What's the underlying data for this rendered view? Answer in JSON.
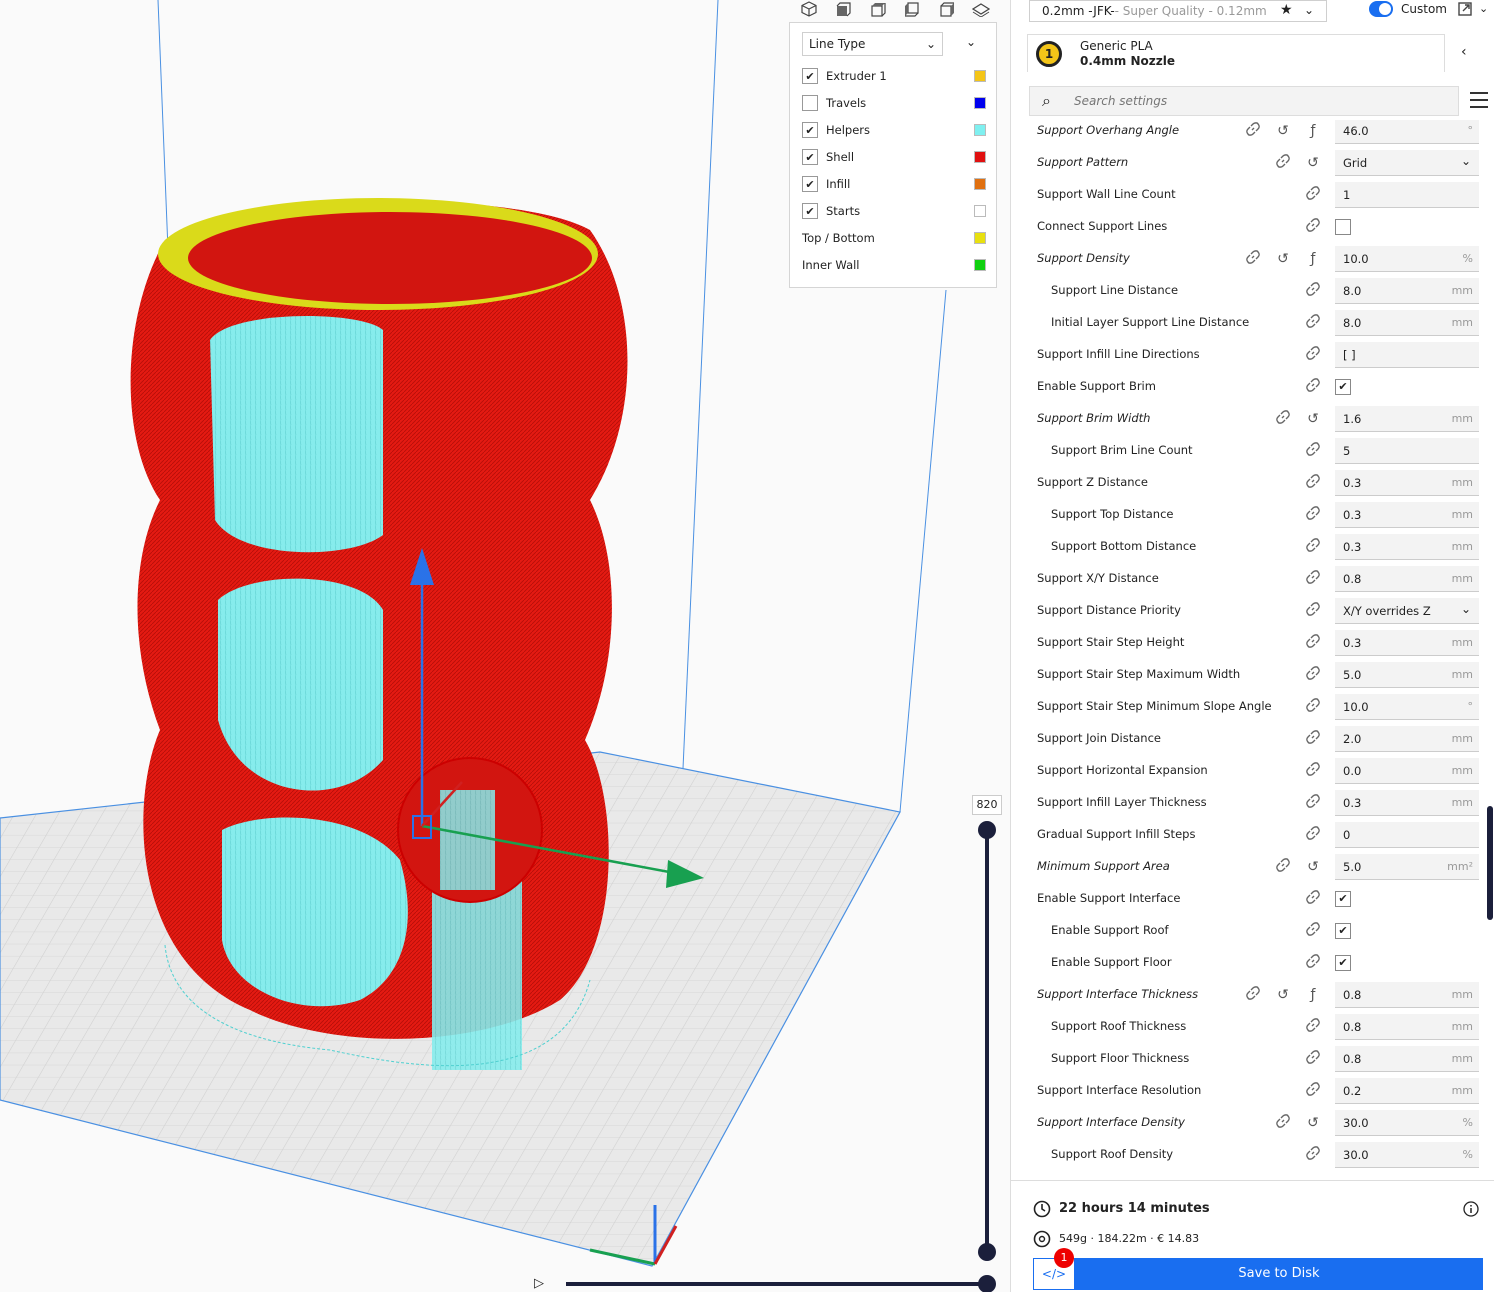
{
  "legend": {
    "dropdown": "Line Type",
    "items": [
      {
        "label": "Extruder 1",
        "checked": true,
        "has_checkbox": true,
        "color": "#f4c518"
      },
      {
        "label": "Travels",
        "checked": false,
        "has_checkbox": true,
        "color": "#0000ee"
      },
      {
        "label": "Helpers",
        "checked": true,
        "has_checkbox": true,
        "color": "#7ff0f0"
      },
      {
        "label": "Shell",
        "checked": true,
        "has_checkbox": true,
        "color": "#e01010"
      },
      {
        "label": "Infill",
        "checked": true,
        "has_checkbox": true,
        "color": "#e07010"
      },
      {
        "label": "Starts",
        "checked": true,
        "has_checkbox": true,
        "color": "#ffffff"
      },
      {
        "label": "Top / Bottom",
        "checked": false,
        "has_checkbox": false,
        "color": "#e8e010"
      },
      {
        "label": "Inner Wall",
        "checked": false,
        "has_checkbox": false,
        "color": "#10d010"
      }
    ]
  },
  "layer": {
    "current": "820"
  },
  "header": {
    "profile_main": "0.2mm -JFK- ",
    "profile_sub": "- Super Quality - 0.12mm",
    "mode_label": "Custom"
  },
  "material": {
    "extruder": "1",
    "name": "Generic PLA",
    "nozzle": "0.4mm Nozzle"
  },
  "search": {
    "placeholder": "Search settings"
  },
  "settings": [
    {
      "label": "Support Overhang Angle",
      "value": "46.0",
      "unit": "°",
      "style": "it",
      "icons": [
        "link",
        "reset",
        "fx"
      ]
    },
    {
      "label": "Support Pattern",
      "value": "Grid",
      "unit": "",
      "style": "it",
      "dropdown": true,
      "icons": [
        "link",
        "reset"
      ]
    },
    {
      "label": "Support Wall Line Count",
      "value": "1",
      "unit": "",
      "icons": [
        "link"
      ]
    },
    {
      "label": "Connect Support Lines",
      "checkbox": true,
      "checked": false,
      "icons": [
        "link"
      ]
    },
    {
      "label": "Support Density",
      "value": "10.0",
      "unit": "%",
      "style": "it",
      "icons": [
        "link",
        "reset",
        "fx"
      ]
    },
    {
      "label": "Support Line Distance",
      "value": "8.0",
      "unit": "mm",
      "indent": true,
      "icons": [
        "link"
      ]
    },
    {
      "label": "Initial Layer Support Line Distance",
      "value": "8.0",
      "unit": "mm",
      "indent": true,
      "icons": [
        "link"
      ]
    },
    {
      "label": "Support Infill Line Directions",
      "value": "[ ]",
      "unit": "",
      "icons": [
        "link"
      ]
    },
    {
      "label": "Enable Support Brim",
      "checkbox": true,
      "checked": true,
      "icons": [
        "link"
      ]
    },
    {
      "label": "Support Brim Width",
      "value": "1.6",
      "unit": "mm",
      "style": "it",
      "icons": [
        "link",
        "reset"
      ]
    },
    {
      "label": "Support Brim Line Count",
      "value": "5",
      "unit": "",
      "indent": true,
      "icons": [
        "link"
      ]
    },
    {
      "label": "Support Z Distance",
      "value": "0.3",
      "unit": "mm",
      "icons": [
        "link"
      ]
    },
    {
      "label": "Support Top Distance",
      "value": "0.3",
      "unit": "mm",
      "indent": true,
      "icons": [
        "link"
      ]
    },
    {
      "label": "Support Bottom Distance",
      "value": "0.3",
      "unit": "mm",
      "indent": true,
      "icons": [
        "link"
      ]
    },
    {
      "label": "Support X/Y Distance",
      "value": "0.8",
      "unit": "mm",
      "icons": [
        "link"
      ]
    },
    {
      "label": "Support Distance Priority",
      "value": "X/Y overrides Z",
      "unit": "",
      "dropdown": true,
      "icons": [
        "link"
      ]
    },
    {
      "label": "Support Stair Step Height",
      "value": "0.3",
      "unit": "mm",
      "icons": [
        "link"
      ]
    },
    {
      "label": "Support Stair Step Maximum Width",
      "value": "5.0",
      "unit": "mm",
      "icons": [
        "link"
      ]
    },
    {
      "label": "Support Stair Step Minimum Slope Angle",
      "value": "10.0",
      "unit": "°",
      "icons": [
        "link"
      ]
    },
    {
      "label": "Support Join Distance",
      "value": "2.0",
      "unit": "mm",
      "icons": [
        "link"
      ]
    },
    {
      "label": "Support Horizontal Expansion",
      "value": "0.0",
      "unit": "mm",
      "icons": [
        "link"
      ]
    },
    {
      "label": "Support Infill Layer Thickness",
      "value": "0.3",
      "unit": "mm",
      "icons": [
        "link"
      ]
    },
    {
      "label": "Gradual Support Infill Steps",
      "value": "0",
      "unit": "",
      "icons": [
        "link"
      ]
    },
    {
      "label": "Minimum Support Area",
      "value": "5.0",
      "unit": "mm²",
      "style": "it",
      "icons": [
        "link",
        "reset"
      ]
    },
    {
      "label": "Enable Support Interface",
      "checkbox": true,
      "checked": true,
      "icons": [
        "link"
      ]
    },
    {
      "label": "Enable Support Roof",
      "checkbox": true,
      "checked": true,
      "indent": true,
      "icons": [
        "link"
      ]
    },
    {
      "label": "Enable Support Floor",
      "checkbox": true,
      "checked": true,
      "indent": true,
      "icons": [
        "link"
      ]
    },
    {
      "label": "Support Interface Thickness",
      "value": "0.8",
      "unit": "mm",
      "style": "it",
      "icons": [
        "link",
        "reset",
        "fx"
      ]
    },
    {
      "label": "Support Roof Thickness",
      "value": "0.8",
      "unit": "mm",
      "indent": true,
      "icons": [
        "link"
      ]
    },
    {
      "label": "Support Floor Thickness",
      "value": "0.8",
      "unit": "mm",
      "indent": true,
      "icons": [
        "link"
      ]
    },
    {
      "label": "Support Interface Resolution",
      "value": "0.2",
      "unit": "mm",
      "icons": [
        "link"
      ]
    },
    {
      "label": "Support Interface Density",
      "value": "30.0",
      "unit": "%",
      "style": "it",
      "icons": [
        "link",
        "reset"
      ]
    },
    {
      "label": "Support Roof Density",
      "value": "30.0",
      "unit": "%",
      "indent": true,
      "icons": [
        "link"
      ]
    }
  ],
  "footer": {
    "time": "22 hours 14 minutes",
    "estimate": "549g · 184.22m · € 14.83",
    "notification_count": "1",
    "code_icon": "</>",
    "save_label": "Save to Disk"
  }
}
